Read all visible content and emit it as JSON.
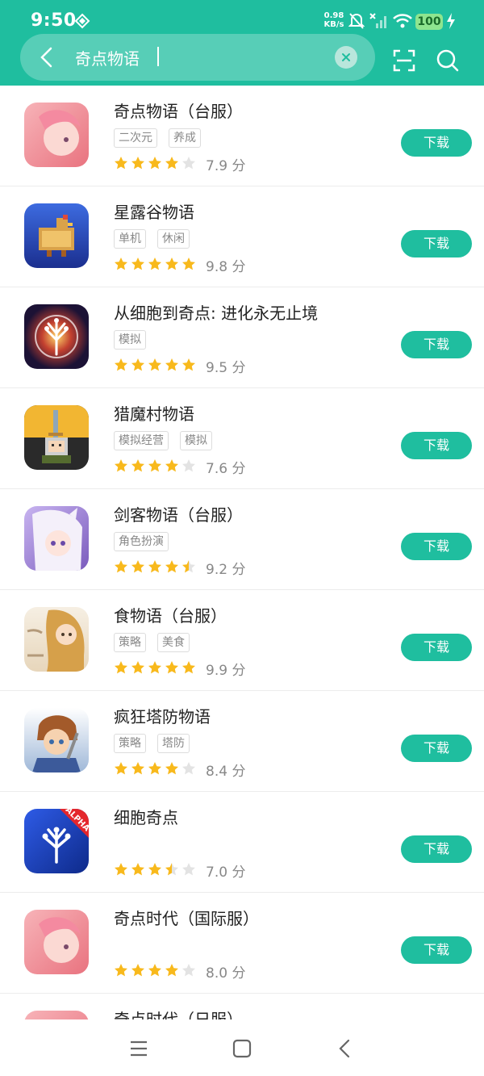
{
  "status_bar": {
    "time": "9:50",
    "net_speed_value": "0.98",
    "net_speed_unit": "KB/s",
    "battery": "100"
  },
  "search": {
    "query": "奇点物语",
    "icons": [
      "back-arrow",
      "clear-x",
      "scan",
      "search"
    ]
  },
  "colors": {
    "accent": "#1fbe9f",
    "star": "#f8b91c",
    "star_empty": "#e3e3e3"
  },
  "results": [
    {
      "title": "奇点物语（台服）",
      "tags": [
        "二次元",
        "养成"
      ],
      "rating": 4,
      "score": "7.9 分",
      "button": "下载"
    },
    {
      "title": "星露谷物语",
      "tags": [
        "单机",
        "休闲"
      ],
      "rating": 5,
      "score": "9.8 分",
      "button": "下载"
    },
    {
      "title": "从细胞到奇点: 进化永无止境",
      "tags": [
        "模拟"
      ],
      "rating": 5,
      "score": "9.5 分",
      "button": "下载"
    },
    {
      "title": "猎魔村物语",
      "tags": [
        "模拟经营",
        "模拟"
      ],
      "rating": 4,
      "score": "7.6 分",
      "button": "下载"
    },
    {
      "title": "剑客物语（台服）",
      "tags": [
        "角色扮演"
      ],
      "rating": 4.5,
      "score": "9.2 分",
      "button": "下载"
    },
    {
      "title": "食物语（台服）",
      "tags": [
        "策略",
        "美食"
      ],
      "rating": 5,
      "score": "9.9 分",
      "button": "下载"
    },
    {
      "title": "疯狂塔防物语",
      "tags": [
        "策略",
        "塔防"
      ],
      "rating": 4,
      "score": "8.4 分",
      "button": "下载"
    },
    {
      "title": "细胞奇点",
      "tags": [],
      "rating": 3.5,
      "score": "7.0 分",
      "button": "下载"
    },
    {
      "title": "奇点时代（国际服）",
      "tags": [],
      "rating": 4,
      "score": "8.0 分",
      "button": "下载"
    },
    {
      "title": "奇点时代（日服）",
      "tags": [],
      "rating": 0,
      "score": "",
      "button": ""
    }
  ],
  "nav": [
    "menu",
    "home",
    "back"
  ]
}
